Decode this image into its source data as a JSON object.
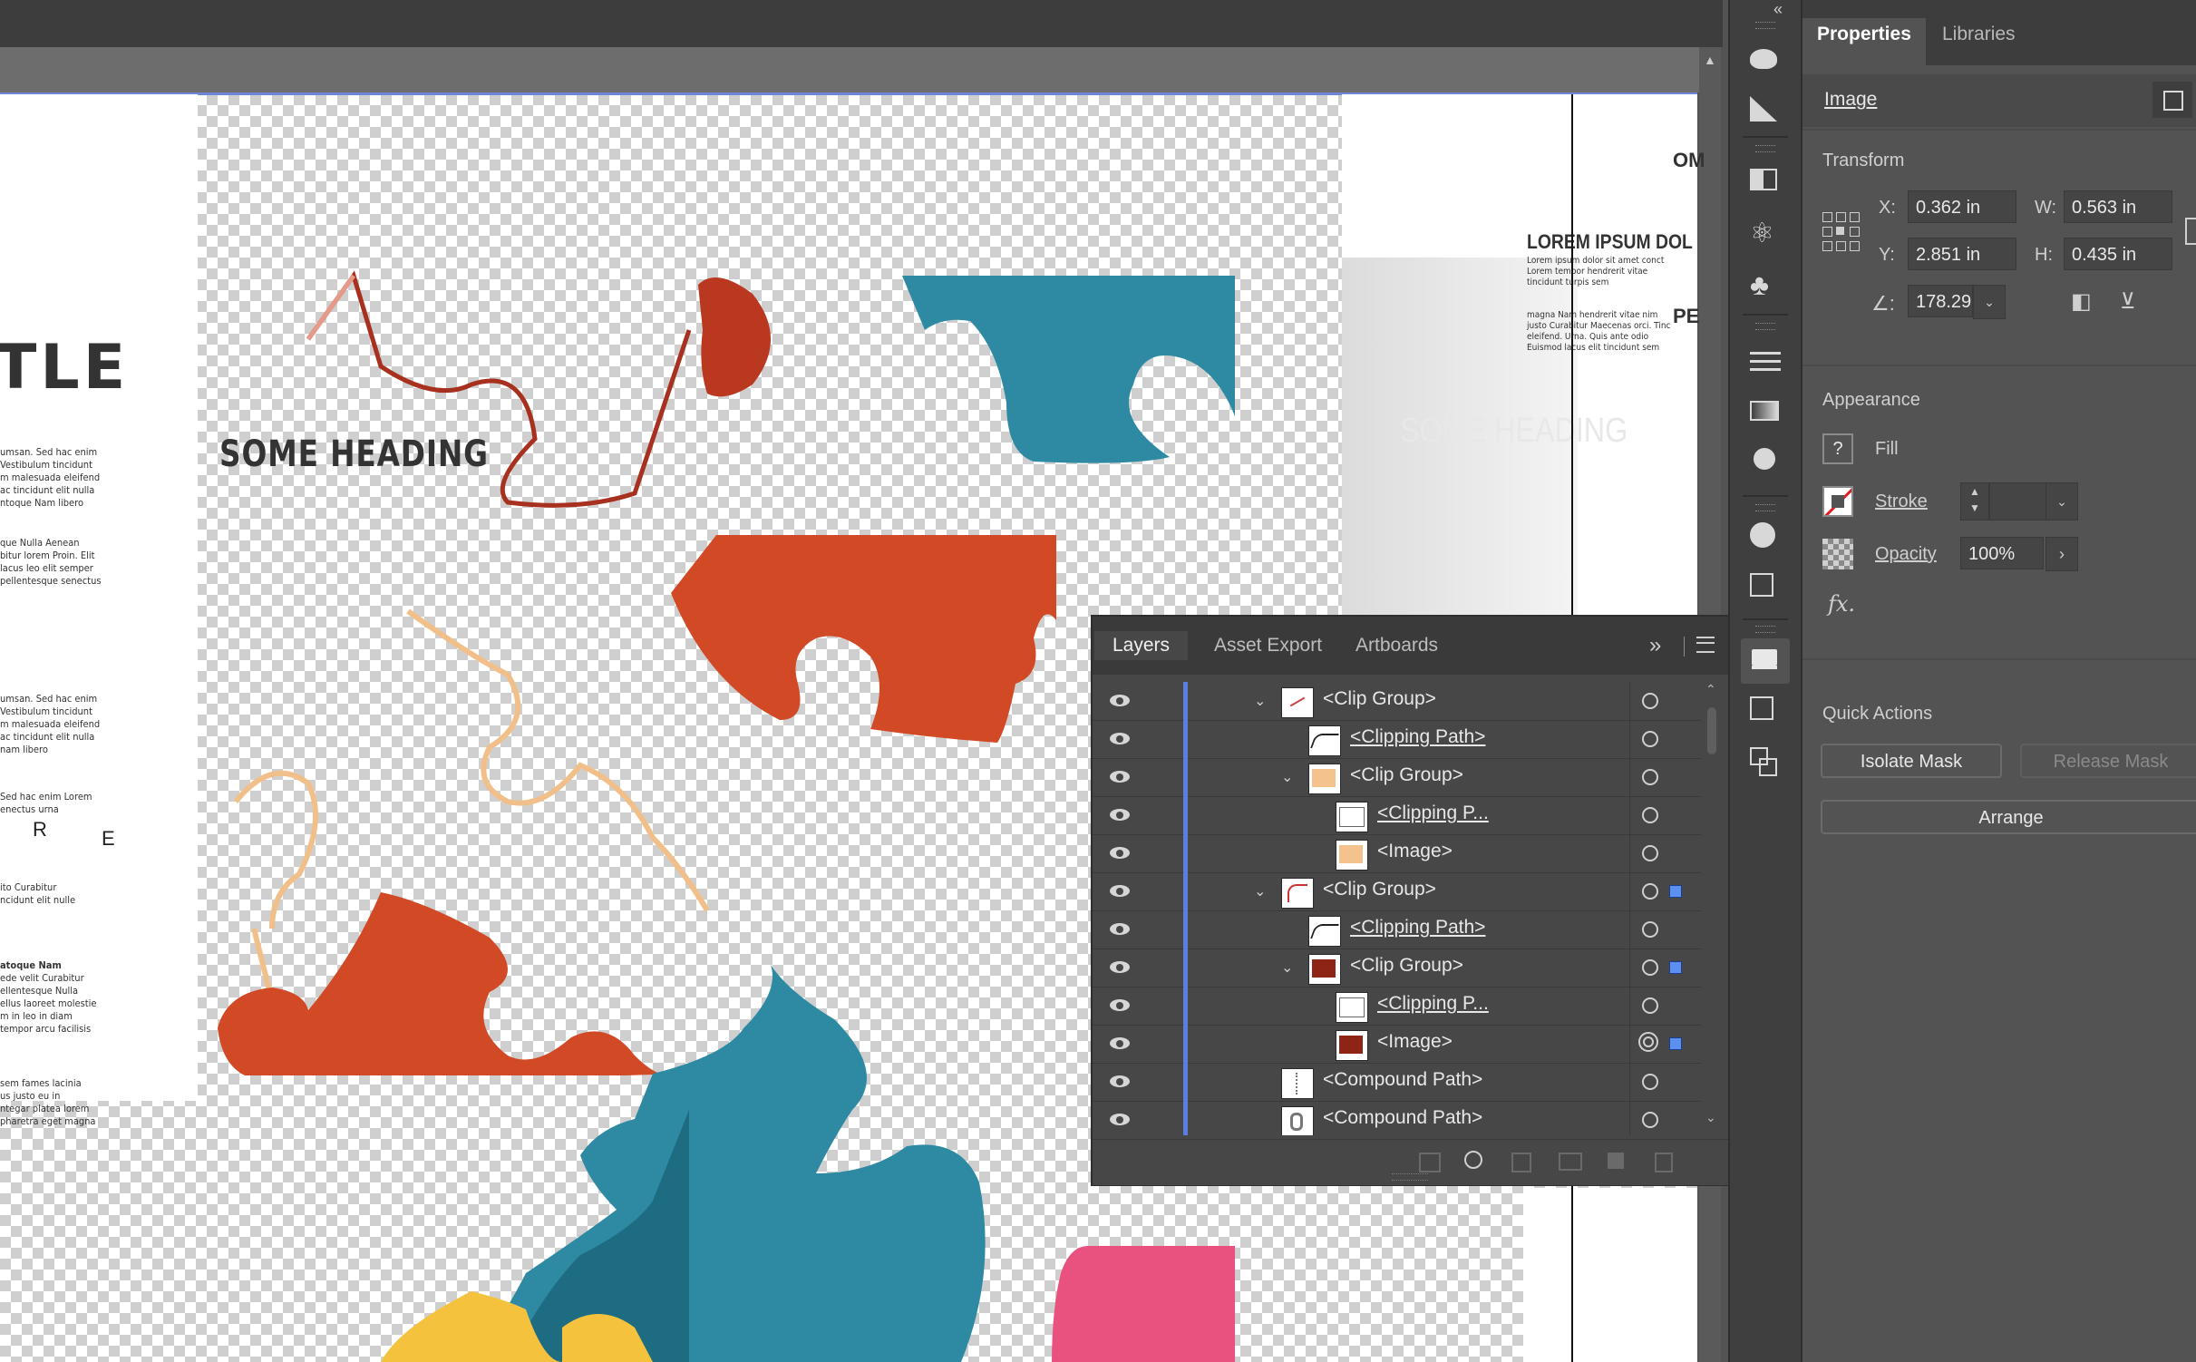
{
  "canvas": {
    "left_page": {
      "title_fragment": "TLE",
      "heading": "SOME HEADING",
      "body1": "umsan. Sed hac enim\nVestibulum tincidunt\nm malesuada eleifend\nac tincidunt elit nulla\nntoque Nam libero",
      "body2": "que Nulla Aenean\nbitur lorem Proin. Elit\nlacus leo elit semper\npellentesque senectus",
      "body3": "umsan. Sed hac enim\nVestibulum tincidunt\nm malesuada eleifend\nac tincidunt elit nulla\nnam libero",
      "body4": "Sed hac enim Lorem\nenectus urna",
      "letters1": "R",
      "letters2": "E",
      "body5": "ito Curabitur\nncidunt elit nulle",
      "body6_head": "atoque Nam",
      "body6": "ede velit Curabitur\nellentesque Nulla\nellus laoreet molestie\nm in leo in diam\ntempor arcu facilisis",
      "body7": "sem fames lacinia\nus justo eu in\nntegar platea lorem\npharetra eget magna"
    },
    "right_page": {
      "heading_fragment": "LOREM IPSUM DOL",
      "top_fragment": "OM",
      "mid_fragment": "PE",
      "body1": "Lorem ipsum dolor sit amet conct\nLorem tempor hendrerit vitae\ntincidunt turpis sem",
      "body2": "magna Nam hendrerit vitae nim\njusto Curabitur Maecenas orci. Tinc\neleifend. Urna. Quis ante odio\nEuismod lacus elit tincidunt sem",
      "ghost_heading": "SOME HEADING"
    }
  },
  "layers_panel": {
    "tabs": [
      "Layers",
      "Asset Export",
      "Artboards"
    ],
    "active_tab": "Layers",
    "rows": [
      {
        "name": "<Clip Group>",
        "indent": 0,
        "expanded": true,
        "underlined": false,
        "thumb": "line",
        "selected": false,
        "targeted": false
      },
      {
        "name": "<Clipping Path>",
        "indent": 1,
        "expanded": null,
        "underlined": true,
        "thumb": "path",
        "selected": false,
        "targeted": false
      },
      {
        "name": "<Clip Group>",
        "indent": 1,
        "expanded": true,
        "underlined": false,
        "thumb": "peach",
        "selected": false,
        "targeted": false
      },
      {
        "name": "<Clipping P...",
        "indent": 2,
        "expanded": null,
        "underlined": true,
        "thumb": "blank",
        "selected": false,
        "targeted": false
      },
      {
        "name": "<Image>",
        "indent": 2,
        "expanded": null,
        "underlined": false,
        "thumb": "peach",
        "selected": false,
        "targeted": false
      },
      {
        "name": "<Clip Group>",
        "indent": 0,
        "expanded": true,
        "underlined": false,
        "thumb": "red-line",
        "selected": true,
        "targeted": false
      },
      {
        "name": "<Clipping Path>",
        "indent": 1,
        "expanded": null,
        "underlined": true,
        "thumb": "path",
        "selected": false,
        "targeted": false
      },
      {
        "name": "<Clip Group>",
        "indent": 1,
        "expanded": true,
        "underlined": false,
        "thumb": "maroon",
        "selected": true,
        "targeted": false
      },
      {
        "name": "<Clipping P...",
        "indent": 2,
        "expanded": null,
        "underlined": true,
        "thumb": "blank",
        "selected": false,
        "targeted": false
      },
      {
        "name": "<Image>",
        "indent": 2,
        "expanded": null,
        "underlined": false,
        "thumb": "maroon",
        "selected": true,
        "targeted": true
      },
      {
        "name": "<Compound Path>",
        "indent": 0,
        "expanded": null,
        "underlined": false,
        "thumb": "dashes",
        "selected": false,
        "targeted": false
      },
      {
        "name": "<Compound Path>",
        "indent": 0,
        "expanded": null,
        "underlined": false,
        "thumb": "lock",
        "selected": false,
        "targeted": false
      }
    ]
  },
  "properties_panel": {
    "tabs": [
      "Properties",
      "Libraries"
    ],
    "active_tab": "Properties",
    "object_type": "Image",
    "transform": {
      "title": "Transform",
      "x_label": "X:",
      "x": "0.362 in",
      "y_label": "Y:",
      "y": "2.851 in",
      "w_label": "W:",
      "w": "0.563 in",
      "h_label": "H:",
      "h": "0.435 in",
      "angle": "178.29"
    },
    "appearance": {
      "title": "Appearance",
      "fill_label": "Fill",
      "stroke_label": "Stroke",
      "opacity_label": "Opacity",
      "opacity": "100%",
      "fx_label": "fx."
    },
    "quick_actions": {
      "title": "Quick Actions",
      "isolate_mask": "Isolate Mask",
      "release_mask": "Release Mask",
      "arrange": "Arrange"
    }
  },
  "colors": {
    "selection": "#5c8ff0",
    "layer_bar": "#5c7ee0",
    "puzzle_teal": "#2f8aa3",
    "puzzle_orange": "#d9482a",
    "puzzle_yellow": "#f5c23e",
    "puzzle_pink": "#e9527e",
    "puzzle_maroon": "#a8301f"
  }
}
